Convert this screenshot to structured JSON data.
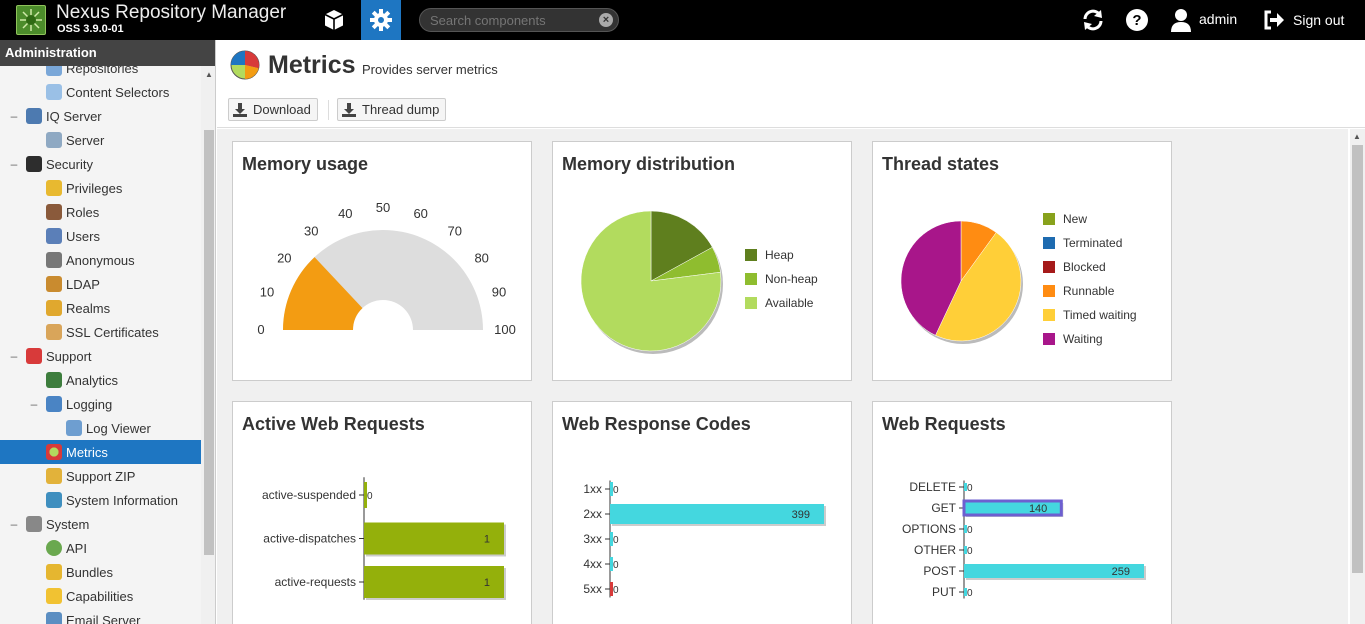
{
  "header": {
    "app_title": "Nexus Repository Manager",
    "version": "OSS 3.9.0-01",
    "search_placeholder": "Search components",
    "user": "admin",
    "sign_out": "Sign out",
    "icons": {
      "browse": "cube-icon",
      "admin": "gear-icon",
      "refresh": "refresh-icon",
      "help": "help-icon",
      "user": "user-icon",
      "signout": "sign-out-icon"
    }
  },
  "sidebar": {
    "title": "Administration",
    "items": [
      {
        "label": "Repositories",
        "indent": 1,
        "icon": "repositories-icon"
      },
      {
        "label": "Content Selectors",
        "indent": 1,
        "icon": "content-selectors-icon"
      },
      {
        "label": "IQ Server",
        "indent": 0,
        "icon": "iq-server-icon",
        "twisty": "–"
      },
      {
        "label": "Server",
        "indent": 1,
        "icon": "server-icon"
      },
      {
        "label": "Security",
        "indent": 0,
        "icon": "security-icon",
        "twisty": "–"
      },
      {
        "label": "Privileges",
        "indent": 1,
        "icon": "privileges-icon"
      },
      {
        "label": "Roles",
        "indent": 1,
        "icon": "roles-icon"
      },
      {
        "label": "Users",
        "indent": 1,
        "icon": "users-icon"
      },
      {
        "label": "Anonymous",
        "indent": 1,
        "icon": "anonymous-icon"
      },
      {
        "label": "LDAP",
        "indent": 1,
        "icon": "ldap-icon"
      },
      {
        "label": "Realms",
        "indent": 1,
        "icon": "realms-icon"
      },
      {
        "label": "SSL Certificates",
        "indent": 1,
        "icon": "ssl-certificates-icon"
      },
      {
        "label": "Support",
        "indent": 0,
        "icon": "support-icon",
        "twisty": "–"
      },
      {
        "label": "Analytics",
        "indent": 1,
        "icon": "analytics-icon"
      },
      {
        "label": "Logging",
        "indent": 1,
        "icon": "logging-icon",
        "twisty": "–"
      },
      {
        "label": "Log Viewer",
        "indent": 2,
        "icon": "log-viewer-icon"
      },
      {
        "label": "Metrics",
        "indent": 1,
        "icon": "metrics-icon",
        "selected": true
      },
      {
        "label": "Support ZIP",
        "indent": 1,
        "icon": "support-zip-icon"
      },
      {
        "label": "System Information",
        "indent": 1,
        "icon": "system-information-icon"
      },
      {
        "label": "System",
        "indent": 0,
        "icon": "system-icon",
        "twisty": "–"
      },
      {
        "label": "API",
        "indent": 1,
        "icon": "api-icon"
      },
      {
        "label": "Bundles",
        "indent": 1,
        "icon": "bundles-icon"
      },
      {
        "label": "Capabilities",
        "indent": 1,
        "icon": "capabilities-icon"
      },
      {
        "label": "Email Server",
        "indent": 1,
        "icon": "email-server-icon"
      }
    ]
  },
  "page": {
    "title": "Metrics",
    "subtitle": "Provides server metrics",
    "download_label": "Download",
    "thread_dump_label": "Thread dump"
  },
  "colors": {
    "accent": "#1e76c2",
    "gauge_fill": "#f39c12",
    "gauge_bg": "#dddddd",
    "heap": "#5f7f1e",
    "nonheap": "#8fbd2f",
    "available": "#b2db5e",
    "bar_olive": "#94b00b",
    "bar_cyan": "#44d7df",
    "bar_red": "#d83a3a",
    "new": "#88a21c",
    "terminated": "#1e6bb0",
    "blocked": "#a51a1a",
    "runnable": "#ff8c12",
    "timed_waiting": "#ffcf38",
    "waiting": "#a8168a"
  },
  "chart_data": [
    {
      "type": "gauge",
      "title": "Memory usage",
      "value": 26,
      "min": 0,
      "max": 100,
      "ticks": [
        "0",
        "10",
        "20",
        "30",
        "40",
        "50",
        "60",
        "70",
        "80",
        "90",
        "100"
      ]
    },
    {
      "type": "pie",
      "title": "Memory distribution",
      "labels": [
        "Heap",
        "Non-heap",
        "Available"
      ],
      "values": [
        17,
        6,
        77
      ]
    },
    {
      "type": "pie",
      "title": "Thread states",
      "labels": [
        "New",
        "Terminated",
        "Blocked",
        "Runnable",
        "Timed waiting",
        "Waiting"
      ],
      "values": [
        0,
        0,
        0,
        10,
        47,
        43
      ]
    },
    {
      "type": "bar",
      "orientation": "horizontal",
      "title": "Active Web Requests",
      "categories": [
        "active-suspended",
        "active-dispatches",
        "active-requests"
      ],
      "values": [
        0,
        1,
        1
      ],
      "xlim": [
        0,
        1
      ]
    },
    {
      "type": "bar",
      "orientation": "horizontal",
      "title": "Web Response Codes",
      "categories": [
        "1xx",
        "2xx",
        "3xx",
        "4xx",
        "5xx"
      ],
      "values": [
        0,
        399,
        0,
        0,
        0
      ],
      "xlim": [
        0,
        399
      ]
    },
    {
      "type": "bar",
      "orientation": "horizontal",
      "title": "Web Requests",
      "categories": [
        "DELETE",
        "GET",
        "OPTIONS",
        "OTHER",
        "POST",
        "PUT"
      ],
      "values": [
        0,
        140,
        0,
        0,
        259,
        0
      ],
      "xlim": [
        0,
        259
      ]
    }
  ]
}
